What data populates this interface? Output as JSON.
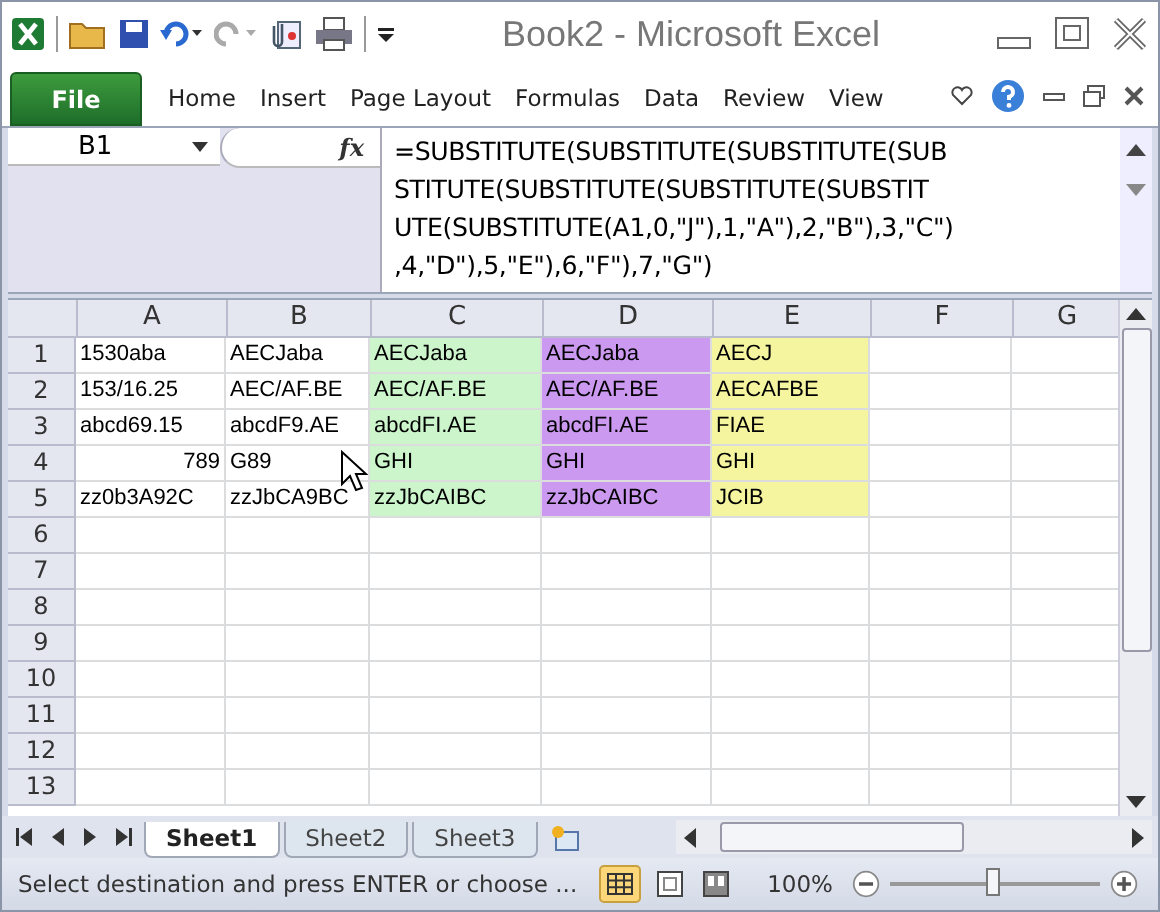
{
  "window": {
    "title": "Book2  -  Microsoft Excel"
  },
  "ribbon_tabs": [
    {
      "label": "File",
      "kind": "file"
    },
    {
      "label": "Home",
      "kind": "tab"
    },
    {
      "label": "Insert",
      "kind": "tab"
    },
    {
      "label": "Page Layout",
      "kind": "tab"
    },
    {
      "label": "Formulas",
      "kind": "tab"
    },
    {
      "label": "Data",
      "kind": "tab"
    },
    {
      "label": "Review",
      "kind": "tab"
    },
    {
      "label": "View",
      "kind": "tab"
    }
  ],
  "name_box": {
    "value": "B1"
  },
  "formula_bar": {
    "fx": "fx",
    "lines": [
      "=SUBSTITUTE(SUBSTITUTE(SUBSTITUTE(SUB",
      "STITUTE(SUBSTITUTE(SUBSTITUTE(SUBSTIT",
      "UTE(SUBSTITUTE(A1,0,\"J\"),1,\"A\"),2,\"B\"),3,\"C\")",
      ",4,\"D\"),5,\"E\"),6,\"F\"),7,\"G\")"
    ]
  },
  "columns": [
    {
      "label": "A"
    },
    {
      "label": "B"
    },
    {
      "label": "C",
      "color": "#ccf5cc"
    },
    {
      "label": "D",
      "color": "#cc99f0"
    },
    {
      "label": "E",
      "color": "#f5f5a0"
    },
    {
      "label": "F"
    },
    {
      "label": "G"
    }
  ],
  "rows": [
    {
      "label": "1",
      "cells": [
        {
          "text": "1530aba",
          "kind": "text"
        },
        {
          "text": "AECJaba",
          "kind": "text"
        },
        {
          "text": "AECJaba",
          "kind": "text"
        },
        {
          "text": "AECJaba",
          "kind": "text"
        },
        {
          "text": "AECJ",
          "kind": "text"
        }
      ]
    },
    {
      "label": "2",
      "cells": [
        {
          "text": "153/16.25",
          "kind": "text"
        },
        {
          "text": "AEC/AF.BE",
          "kind": "text"
        },
        {
          "text": "AEC/AF.BE",
          "kind": "text"
        },
        {
          "text": "AEC/AF.BE",
          "kind": "text"
        },
        {
          "text": "AECAFBE",
          "kind": "text"
        }
      ]
    },
    {
      "label": "3",
      "cells": [
        {
          "text": "abcd69.15",
          "kind": "text"
        },
        {
          "text": "abcdF9.AE",
          "kind": "text"
        },
        {
          "text": "abcdFI.AE",
          "kind": "text"
        },
        {
          "text": "abcdFI.AE",
          "kind": "text"
        },
        {
          "text": "FIAE",
          "kind": "text"
        }
      ]
    },
    {
      "label": "4",
      "cells": [
        {
          "text": "789",
          "kind": "number"
        },
        {
          "text": "G89",
          "kind": "text"
        },
        {
          "text": "GHI",
          "kind": "text"
        },
        {
          "text": "GHI",
          "kind": "text"
        },
        {
          "text": "GHI",
          "kind": "text"
        }
      ]
    },
    {
      "label": "5",
      "cells": [
        {
          "text": "zz0b3A92C",
          "kind": "text"
        },
        {
          "text": "zzJbCA9BC",
          "kind": "text"
        },
        {
          "text": "zzJbCAIBC",
          "kind": "text"
        },
        {
          "text": "zzJbCAIBC",
          "kind": "text"
        },
        {
          "text": "JCIB",
          "kind": "text"
        }
      ]
    },
    {
      "label": "6",
      "cells": []
    },
    {
      "label": "7",
      "cells": []
    },
    {
      "label": "8",
      "cells": []
    },
    {
      "label": "9",
      "cells": []
    },
    {
      "label": "10",
      "cells": []
    },
    {
      "label": "11",
      "cells": []
    },
    {
      "label": "12",
      "cells": []
    },
    {
      "label": "13",
      "cells": []
    }
  ],
  "sheet_tabs": [
    {
      "label": "Sheet1",
      "selected": true
    },
    {
      "label": "Sheet2",
      "selected": false
    },
    {
      "label": "Sheet3",
      "selected": false
    }
  ],
  "status_bar": {
    "message": "Select destination and press ENTER or choose ...",
    "zoom": "100%",
    "level": 0.5
  }
}
